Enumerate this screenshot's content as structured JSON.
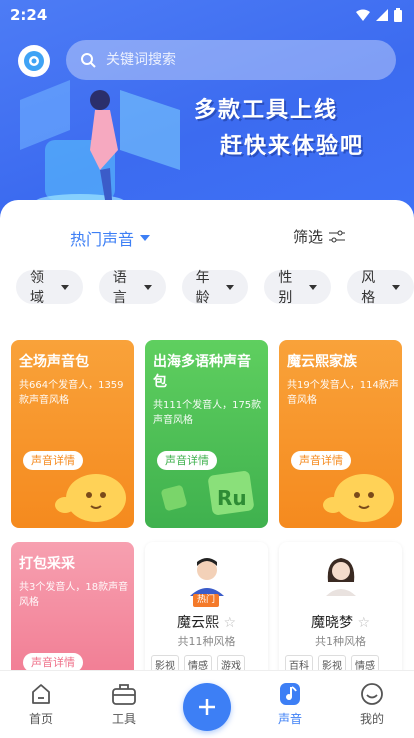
{
  "status": {
    "time": "2:24"
  },
  "search": {
    "placeholder": "关键词搜索"
  },
  "banner": {
    "line1": "多款工具上线",
    "line2": "赶快来体验吧"
  },
  "tabs": {
    "hot": "热门声音",
    "filter": "筛选"
  },
  "chips": [
    "领域",
    "语言",
    "年龄",
    "性别",
    "风格"
  ],
  "cards": [
    {
      "title": "全场声音包",
      "desc": "共664个发音人，1359款声音风格",
      "button": "声音详情",
      "color": "#f79a2e"
    },
    {
      "title": "出海多语种声音包",
      "desc": "共111个发音人，175款声音风格",
      "button": "声音详情",
      "color": "#4cc05a"
    },
    {
      "title": "魔云熙家族",
      "desc": "共19个发音人，114款声音风格",
      "button": "声音详情",
      "color": "#f79a2e"
    },
    {
      "title": "打包采采",
      "desc": "共3个发音人，18款声音风格",
      "button": "声音详情",
      "color": "#f3849a"
    }
  ],
  "people": [
    {
      "name": "魔云熙",
      "meta": "共11种风格",
      "badge": "热门",
      "tags": [
        "影视",
        "情感",
        "游戏"
      ]
    },
    {
      "name": "魔晓梦",
      "meta": "共1种风格",
      "tags": [
        "百科",
        "影视",
        "情感"
      ]
    }
  ],
  "nav": {
    "home": "首页",
    "tools": "工具",
    "voice": "声音",
    "mine": "我的"
  },
  "colors": {
    "primary": "#3d7ff5",
    "orange": "#f79a2e",
    "green": "#4cc05a",
    "pink": "#f3849a"
  }
}
